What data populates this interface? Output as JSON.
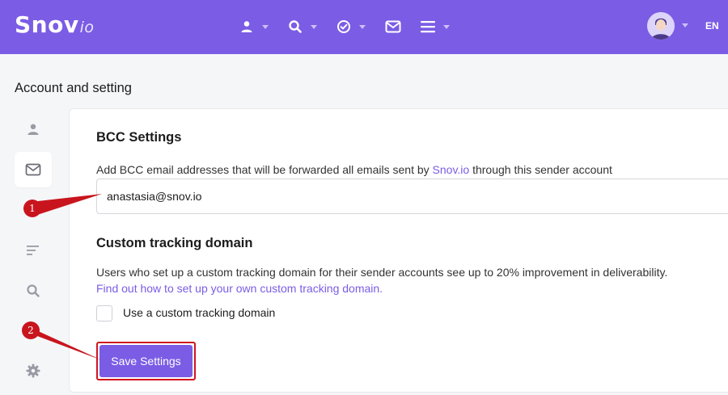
{
  "header": {
    "logo_main": "Snov",
    "logo_suffix": "io",
    "nav_icons": [
      "person-icon",
      "search-icon",
      "check-circle-icon",
      "mail-icon",
      "menu-icon"
    ],
    "language": "EN",
    "brand_color": "#7B5CE5"
  },
  "page": {
    "title": "Account and setting"
  },
  "sidebar": {
    "items": [
      {
        "icon": "person-icon",
        "active": false
      },
      {
        "icon": "mail-icon",
        "active": true
      },
      {
        "icon": "list-icon",
        "active": false
      },
      {
        "icon": "search-icon",
        "active": false
      },
      {
        "icon": "gear-icon",
        "active": false
      }
    ]
  },
  "bcc": {
    "heading": "BCC Settings",
    "description_before": "Add BCC email addresses that will be forwarded all emails sent by ",
    "description_link": "Snov.io",
    "description_after": " through this sender account",
    "email_value": "anastasia@snov.io"
  },
  "tracking": {
    "heading": "Custom tracking domain",
    "description": "Users who set up a custom tracking domain for their sender accounts see up to 20% improvement in deliverability.",
    "link": "Find out how to set up your own custom tracking domain.",
    "checkbox_label": "Use a custom tracking domain",
    "checkbox_checked": false
  },
  "actions": {
    "save_label": "Save Settings"
  },
  "annotations": {
    "marker_1": "1",
    "marker_2": "2",
    "marker_color": "#c8151d"
  }
}
